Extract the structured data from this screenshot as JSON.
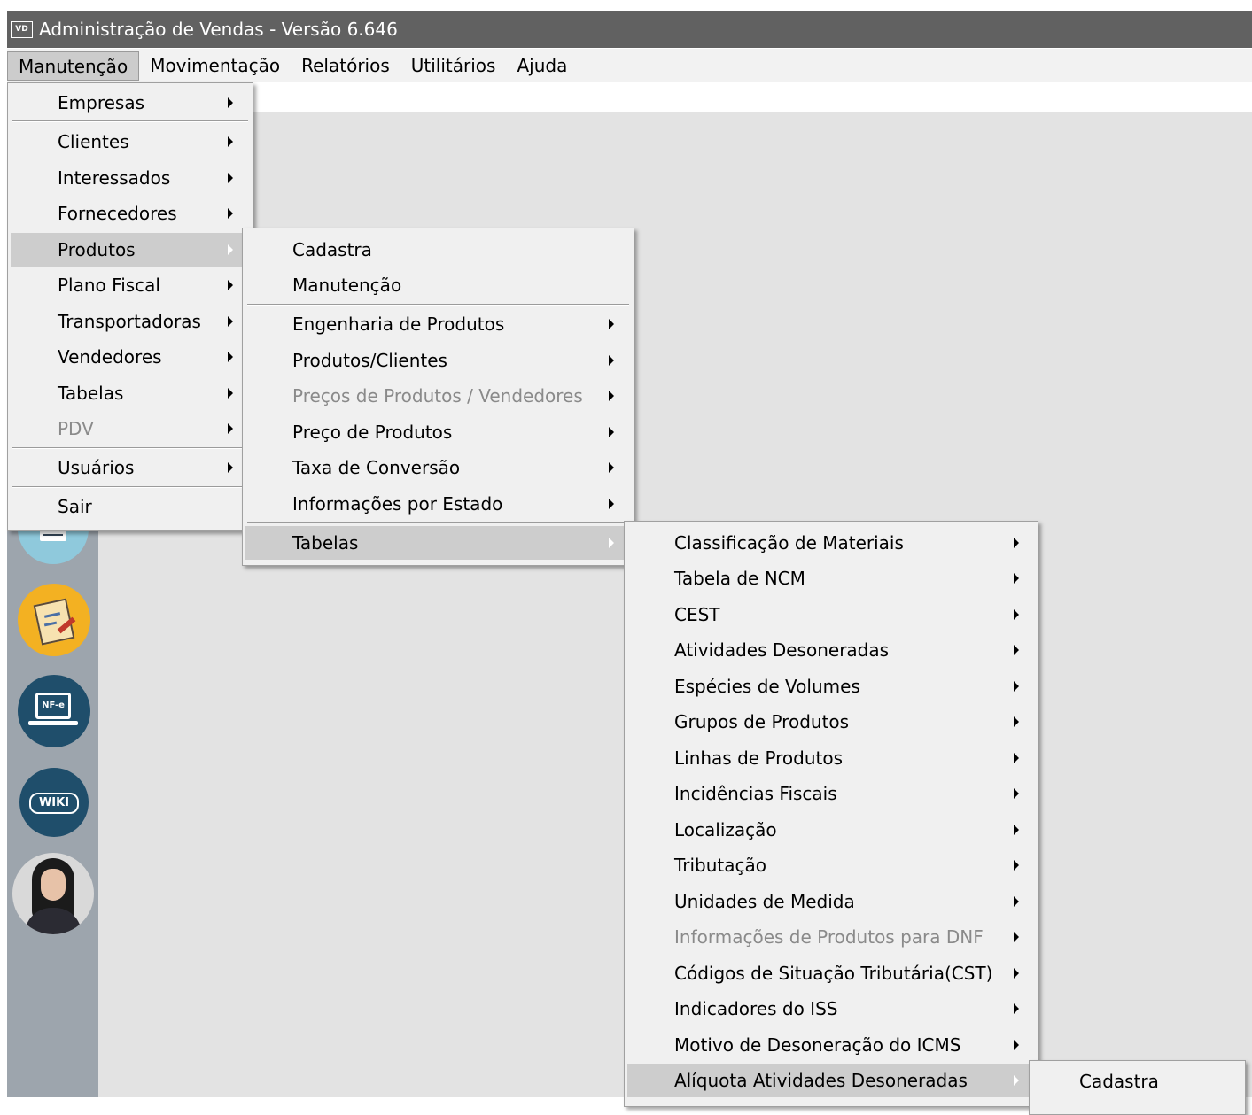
{
  "window": {
    "icon_text": "VD",
    "title": "Administração de Vendas - Versão 6.646"
  },
  "menubar": [
    "Manutenção",
    "Movimentação",
    "Relatórios",
    "Utilitários",
    "Ajuda"
  ],
  "menu_manutencao": {
    "items": [
      "Empresas",
      "Clientes",
      "Interessados",
      "Fornecedores",
      "Produtos",
      "Plano Fiscal",
      "Transportadoras",
      "Vendedores",
      "Tabelas",
      "PDV",
      "Usuários",
      "Sair"
    ],
    "disabled": [
      "PDV"
    ],
    "highlighted": "Produtos"
  },
  "menu_produtos": {
    "items": [
      "Cadastra",
      "Manutenção",
      "Engenharia de Produtos",
      "Produtos/Clientes",
      "Preços de Produtos / Vendedores",
      "Preço de Produtos",
      "Taxa de Conversão",
      "Informações por Estado",
      "Tabelas"
    ],
    "disabled": [
      "Preços de Produtos / Vendedores"
    ],
    "highlighted": "Tabelas"
  },
  "menu_tabelas": {
    "items": [
      "Classificação de Materiais",
      "Tabela de NCM",
      "CEST",
      "Atividades Desoneradas",
      "Espécies de Volumes",
      "Grupos de Produtos",
      "Linhas de Produtos",
      "Incidências Fiscais",
      "Localização",
      "Tributação",
      "Unidades de Medida",
      "Informações de Produtos para DNF",
      "Códigos de Situação Tributária(CST)",
      "Indicadores do ISS",
      "Motivo de Desoneração do ICMS",
      "Alíquota Atividades Desoneradas"
    ],
    "disabled": [
      "Informações de Produtos para DNF"
    ],
    "highlighted": "Alíquota Atividades Desoneradas"
  },
  "menu_aliquota": {
    "items": [
      "Cadastra"
    ]
  },
  "sidebar": {
    "icons": [
      "notes-icon",
      "document-edit-icon",
      "nfe-laptop-icon",
      "wiki-icon",
      "assistant-avatar-icon"
    ],
    "wiki_text": "WIKI",
    "nfe_text": "NF-e"
  },
  "colors": {
    "titlebar": "#616161",
    "workspace": "#e3e3e3",
    "sidebar": "#9da5ad",
    "menu": "#f0f0f0",
    "highlight": "#cdcdcd",
    "disabled": "#8a8a8a"
  }
}
